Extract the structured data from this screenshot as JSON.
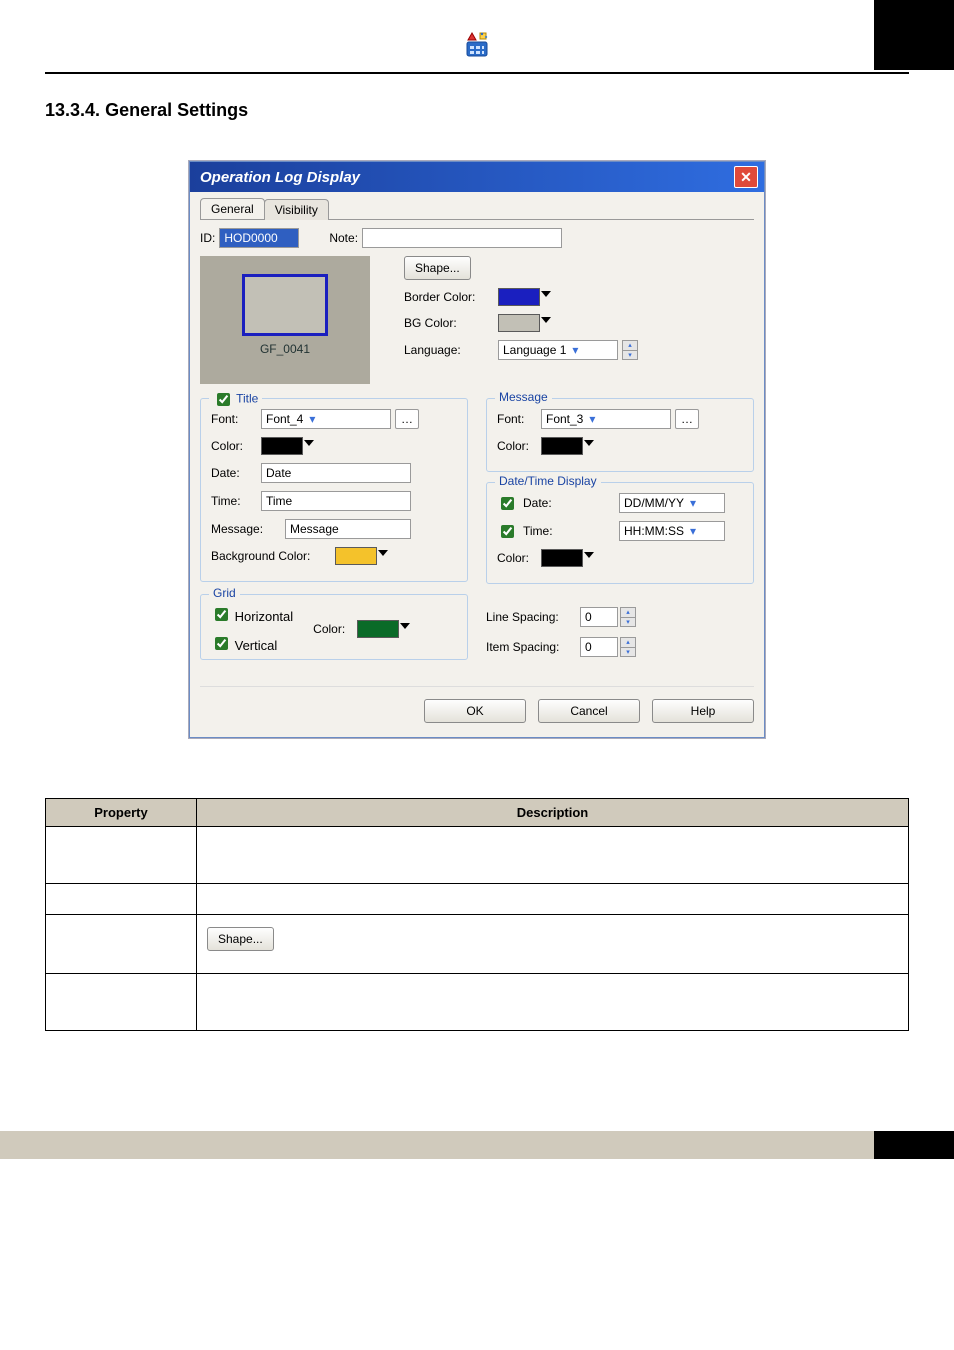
{
  "header": {
    "section_number": "13.3.4.",
    "section_title": "General Settings"
  },
  "dialog": {
    "title": "Operation Log Display",
    "tabs": {
      "general": "General",
      "visibility": "Visibility"
    },
    "id_label": "ID:",
    "id_value": "HOD0000",
    "note_label": "Note:",
    "note_value": "",
    "shape_btn": "Shape...",
    "preview_caption": "GF_0041",
    "border_color_label": "Border Color:",
    "bg_color_label": "BG Color:",
    "language_label": "Language:",
    "language_value": "Language 1",
    "title_group": {
      "legend": "Title",
      "font_label": "Font:",
      "font_value": "Font_4",
      "color_label": "Color:",
      "date_label": "Date:",
      "date_value": "Date",
      "time_label": "Time:",
      "time_value": "Time",
      "message_label": "Message:",
      "message_value": "Message",
      "bgcolor_label": "Background Color:"
    },
    "message_group": {
      "legend": "Message",
      "font_label": "Font:",
      "font_value": "Font_3",
      "color_label": "Color:"
    },
    "datetime_group": {
      "legend": "Date/Time Display",
      "date_label": "Date:",
      "date_fmt": "DD/MM/YY",
      "time_label": "Time:",
      "time_fmt": "HH:MM:SS",
      "color_label": "Color:"
    },
    "grid_group": {
      "legend": "Grid",
      "horizontal": "Horizontal",
      "vertical": "Vertical",
      "color_label": "Color:"
    },
    "line_spacing_label": "Line Spacing:",
    "line_spacing_value": "0",
    "item_spacing_label": "Item Spacing:",
    "item_spacing_value": "0",
    "buttons": {
      "ok": "OK",
      "cancel": "Cancel",
      "help": "Help"
    }
  },
  "table": {
    "property_header": "Property",
    "description_header": "Description",
    "rows": [
      {
        "property": "",
        "description": ""
      },
      {
        "property": "",
        "description": ""
      },
      {
        "property": "",
        "description": ""
      },
      {
        "property": "",
        "description": ""
      }
    ]
  },
  "shape_inline_btn": "Shape..."
}
